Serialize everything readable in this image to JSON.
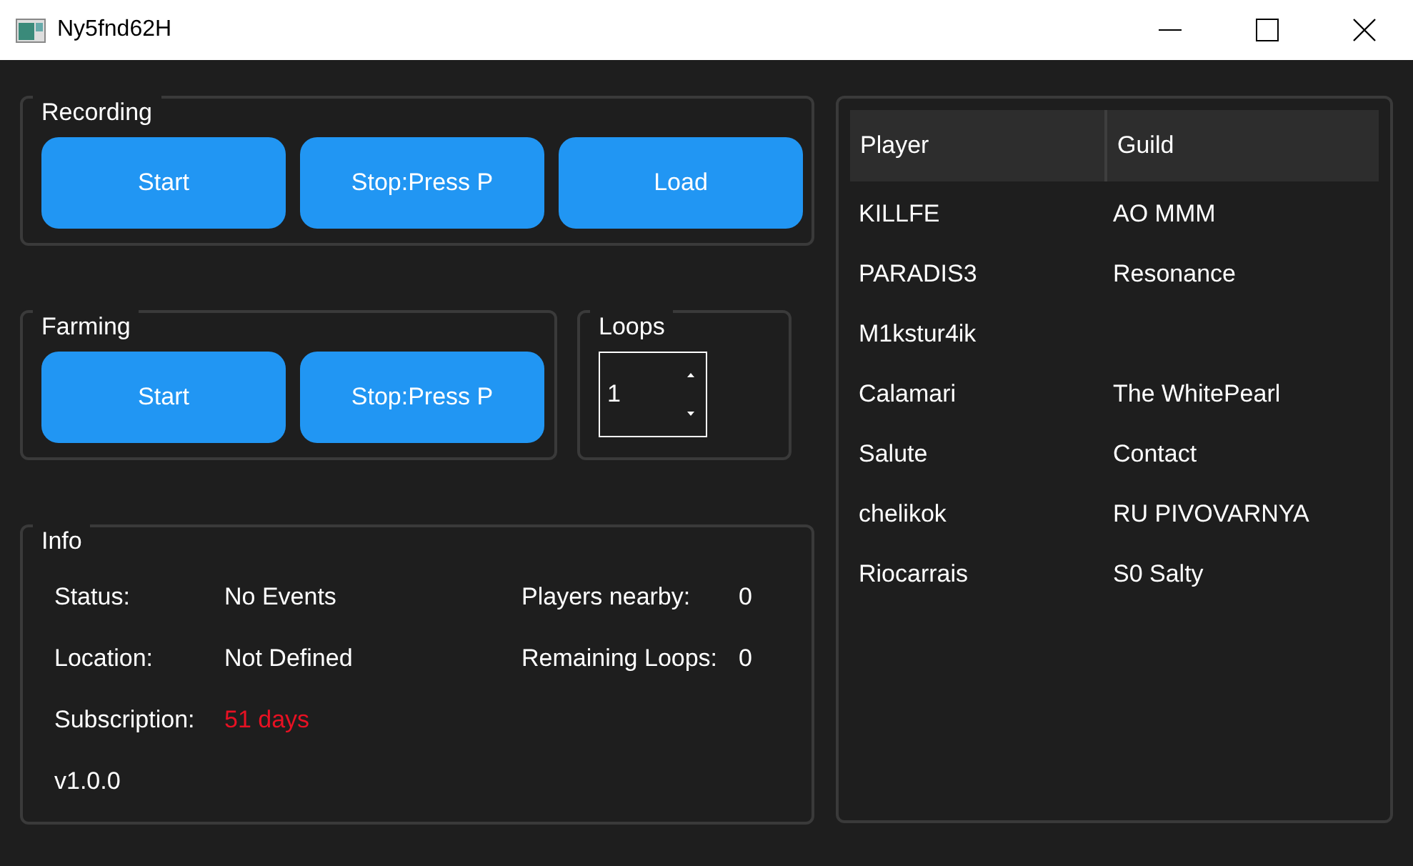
{
  "window": {
    "title": "Ny5fnd62H"
  },
  "recording": {
    "title": "Recording",
    "buttons": [
      "Start",
      "Stop:Press P",
      "Load"
    ]
  },
  "farming": {
    "title": "Farming",
    "buttons": [
      "Start",
      "Stop:Press P"
    ]
  },
  "loops": {
    "title": "Loops",
    "value": "1"
  },
  "info": {
    "title": "Info",
    "rows": [
      [
        {
          "label": "Status:",
          "value": "No Events",
          "alert": false
        },
        {
          "label": "Players nearby:",
          "value": "0",
          "alert": false
        }
      ],
      [
        {
          "label": "Location:",
          "value": "Not Defined",
          "alert": false
        },
        {
          "label": "Remaining Loops:",
          "value": "0",
          "alert": false
        }
      ],
      [
        {
          "label": "Subscription:",
          "value": "51 days",
          "alert": true
        }
      ]
    ],
    "version": "v1.0.0"
  },
  "table": {
    "columns": [
      "Player",
      "Guild"
    ],
    "rows": [
      [
        "KILLFE",
        "AO MMM"
      ],
      [
        "PARADIS3",
        "Resonance"
      ],
      [
        "M1kstur4ik"
      ],
      [
        "Calamari",
        "The WhitePearl"
      ],
      [
        "Salute",
        "Contact"
      ],
      [
        "chelikok",
        "RU PIVOVARNYA"
      ],
      [
        "Riocarrais",
        "S0 Salty"
      ]
    ]
  }
}
